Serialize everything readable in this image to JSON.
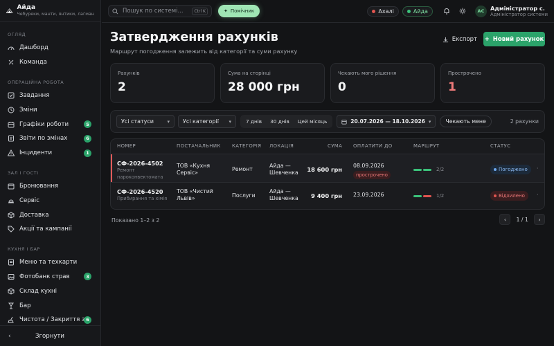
{
  "brand": {
    "name": "Айда",
    "tagline": "Чебуреки, манти, янтики, лагман"
  },
  "sidebar": {
    "sections": [
      {
        "title": "ОГЛЯД",
        "items": [
          {
            "label": "Дашборд",
            "icon": "dashboard-icon"
          },
          {
            "label": "Команда",
            "icon": "team-icon"
          }
        ]
      },
      {
        "title": "ОПЕРАЦІЙНА РОБОТА",
        "items": [
          {
            "label": "Завдання",
            "icon": "tasks-icon"
          },
          {
            "label": "Зміни",
            "icon": "clock-icon"
          },
          {
            "label": "Графіки роботи",
            "icon": "calendar-icon",
            "badge": "5"
          },
          {
            "label": "Звіти по змінах",
            "icon": "report-icon",
            "badge": "6"
          },
          {
            "label": "Інциденти",
            "icon": "warning-icon",
            "badge": "1"
          }
        ]
      },
      {
        "title": "ЗАЛ І ГОСТІ",
        "items": [
          {
            "label": "Бронювання",
            "icon": "booking-icon"
          },
          {
            "label": "Сервіс",
            "icon": "service-icon"
          },
          {
            "label": "Доставка",
            "icon": "delivery-icon"
          },
          {
            "label": "Акції та кампанії",
            "icon": "tag-icon"
          }
        ]
      },
      {
        "title": "КУХНЯ І БАР",
        "items": [
          {
            "label": "Меню та техкарти",
            "icon": "menu-icon"
          },
          {
            "label": "Фотобанк страв",
            "icon": "photo-icon",
            "badge": "3"
          },
          {
            "label": "Склад кухні",
            "icon": "box-icon"
          },
          {
            "label": "Бар",
            "icon": "glass-icon"
          },
          {
            "label": "Чистота / Закриття з...",
            "icon": "broom-icon",
            "badge": "6"
          }
        ]
      }
    ],
    "collapse_label": "Згорнути"
  },
  "topbar": {
    "search_placeholder": "Пошук по системі...",
    "shortcut": "Ctrl K",
    "helper_label": "Помічник",
    "locations": [
      {
        "label": "Ахалі",
        "dot_color": "#e0554f",
        "active": false
      },
      {
        "label": "Айда",
        "dot_color": "#3bc27a",
        "active": true
      }
    ],
    "user": {
      "initials": "АС",
      "name": "Адміністратор с.",
      "role": "Адміністратор системи"
    }
  },
  "page": {
    "title": "Затвердження рахунків",
    "subtitle": "Маршрут погодження залежить від категорії та суми рахунку",
    "export_label": "Експорт",
    "new_label": "Новий рахунок"
  },
  "stats": [
    {
      "label": "Рахунків",
      "value": "2"
    },
    {
      "label": "Сума на сторінці",
      "value": "28 000 грн"
    },
    {
      "label": "Чекають мого рішення",
      "value": "0"
    },
    {
      "label": "Прострочено",
      "value": "1",
      "alert": true
    }
  ],
  "filters": {
    "status_select": "Усі статуси",
    "category_select": "Усі категорії",
    "ranges": [
      "7 днів",
      "30 днів",
      "Цей місяць"
    ],
    "date_range": "20.07.2026 — 18.10.2026",
    "waiting_label": "Чекають мене",
    "count": "2 рахунки"
  },
  "table": {
    "columns": [
      "НОМЕР",
      "ПОСТАЧАЛЬНИК",
      "КАТЕГОРІЯ",
      "ЛОКАЦІЯ",
      "СУМА",
      "ОПЛАТИТИ ДО",
      "МАРШРУТ",
      "СТАТУС"
    ],
    "rows": [
      {
        "number": "СФ-2026-4502",
        "description_l1": "Ремонт",
        "description_l2": "пароконвектомата",
        "supplier_l1": "ТОВ «Кухня",
        "supplier_l2": "Сервіс»",
        "category": "Ремонт",
        "location_l1": "Айда —",
        "location_l2": "Шевченка",
        "amount": "18 600 грн",
        "due": "08.09.2026",
        "overdue_label": "прострочено",
        "route": {
          "steps": [
            "#3bc27a",
            "#3bc27a"
          ],
          "label": "2/2"
        },
        "status": "Погоджено",
        "status_kind": "ok"
      },
      {
        "number": "СФ-2026-4520",
        "description_l1": "Прибирання та хімія",
        "description_l2": "",
        "supplier_l1": "ТОВ «Чистий",
        "supplier_l2": "Львів»",
        "category": "Послуги",
        "location_l1": "Айда —",
        "location_l2": "Шевченка",
        "amount": "9 400 грн",
        "due": "23.09.2026",
        "overdue_label": "",
        "route": {
          "steps": [
            "#3bc27a",
            "#e0554f"
          ],
          "label": "1/2"
        },
        "status": "Відхилено",
        "status_kind": "bad"
      }
    ],
    "footer": "Показано 1–2 з 2",
    "page_label": "1 / 1"
  },
  "colors": {
    "accent": "#2ba36a",
    "danger": "#e0554f",
    "background": "#131416"
  }
}
